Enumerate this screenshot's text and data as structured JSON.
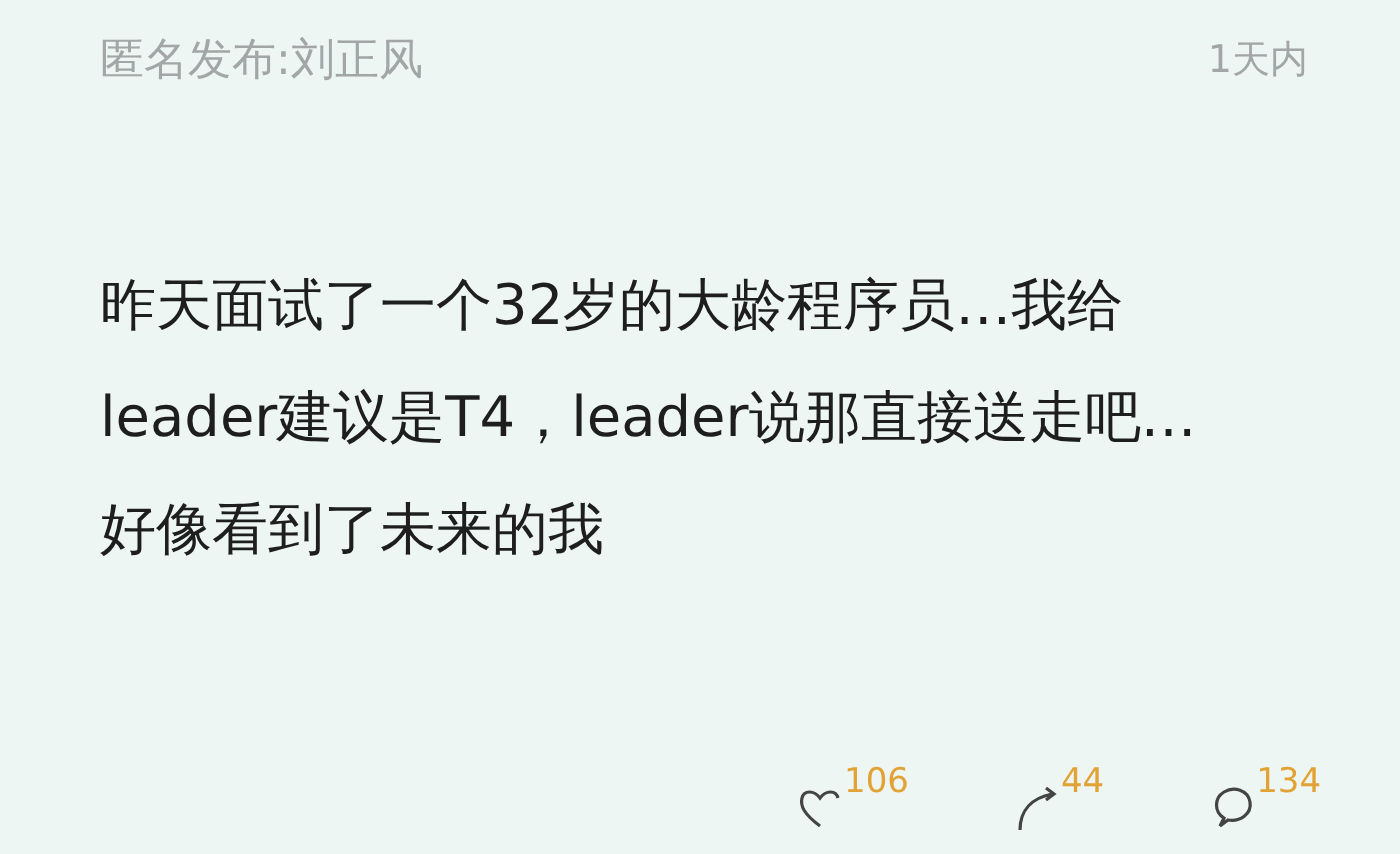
{
  "post": {
    "author": "匿名发布:刘正风",
    "time": "1天内",
    "content_lines": [
      "昨天面试了一个32岁的大龄程序员…我给",
      "leader建议是T4，leader说那直接送走吧…",
      "好像看到了未来的我"
    ],
    "actions": [
      {
        "kind": "like",
        "count": "106"
      },
      {
        "kind": "share",
        "count": "44"
      },
      {
        "kind": "comment",
        "count": "134"
      }
    ]
  }
}
